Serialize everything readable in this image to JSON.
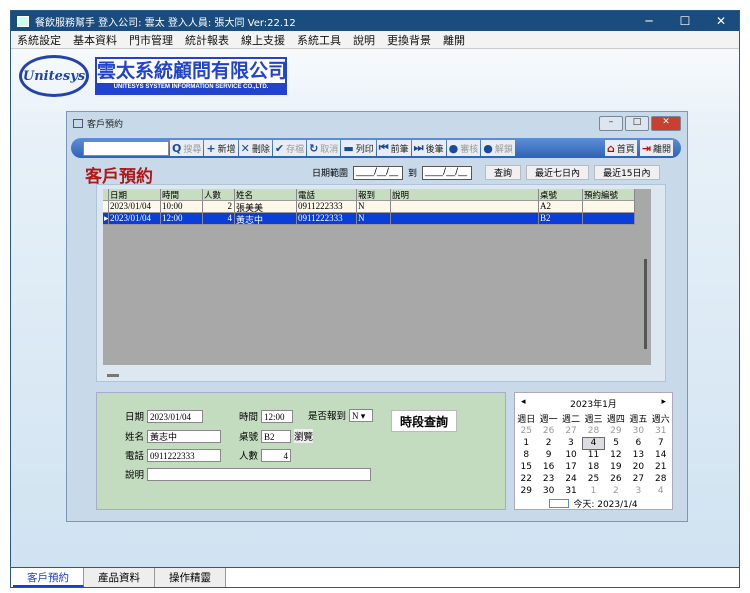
{
  "titlebar": {
    "title": "餐飲服務幫手  登入公司: 雲太  登入人員: 張大同 Ver:22.12",
    "min": "─",
    "max": "☐",
    "close": "✕"
  },
  "menu": [
    "系統設定",
    "基本資料",
    "門市管理",
    "統計報表",
    "線上支援",
    "系統工具",
    "說明",
    "更換背景",
    "離開"
  ],
  "logo": {
    "oval": "Unitesys",
    "cn": "雲太系統顧問有限公司",
    "en": "UNITESYS SYSTEM INFORMATION SERVICE CO.,LTD."
  },
  "child": {
    "title": "客戶預約",
    "heading": "客戶預約"
  },
  "toolbar": {
    "search_value": "",
    "buttons": [
      {
        "icon": "search-icon",
        "label": "搜尋",
        "glyph": "Q",
        "disabled": true
      },
      {
        "icon": "plus-icon",
        "label": "新增",
        "glyph": "+"
      },
      {
        "icon": "x-icon",
        "label": "刪除",
        "glyph": "✕"
      },
      {
        "icon": "check-icon",
        "label": "存檔",
        "glyph": "✔",
        "disabled": true
      },
      {
        "icon": "undo-icon",
        "label": "取消",
        "glyph": "↻",
        "disabled": true
      },
      {
        "icon": "printer-icon",
        "label": "列印",
        "glyph": "▬"
      },
      {
        "icon": "prev-icon",
        "label": "前筆",
        "glyph": "⏮"
      },
      {
        "icon": "next-icon",
        "label": "後筆",
        "glyph": "⏭"
      },
      {
        "icon": "lock-icon",
        "label": "審核",
        "glyph": "●",
        "disabled": true
      },
      {
        "icon": "unlock-icon",
        "label": "解鎖",
        "glyph": "●",
        "disabled": true
      }
    ],
    "home": "首頁",
    "exit": "離開"
  },
  "range": {
    "label": "日期範圍",
    "from": "____/__/__",
    "to_label": "到",
    "to": "____/__/__",
    "query": "查詢",
    "last7": "最近七日內",
    "last15": "最近15日內"
  },
  "grid": {
    "columns": [
      "日期",
      "時間",
      "人數",
      "姓名",
      "電話",
      "報到",
      "說明",
      "桌號",
      "預約編號"
    ],
    "rows": [
      [
        "2023/01/04",
        "10:00",
        "2",
        "張美美",
        "0911222333",
        "N",
        "",
        "A2",
        ""
      ],
      [
        "2023/01/04",
        "12:00",
        "4",
        "黃志中",
        "0911222333",
        "N",
        "",
        "B2",
        ""
      ]
    ],
    "selected": 1
  },
  "form": {
    "date_label": "日期",
    "date": "2023/01/04",
    "time_label": "時間",
    "time": "12:00",
    "checkin_label": "是否報到",
    "checkin": "N",
    "slot_btn": "時段查詢",
    "name_label": "姓名",
    "name": "黃志中",
    "table_label": "桌號",
    "table": "B2",
    "browse": "瀏覽",
    "phone_label": "電話",
    "phone": "0911222333",
    "people_label": "人數",
    "people": "4",
    "note_label": "說明",
    "note": ""
  },
  "calendar": {
    "title": "2023年1月",
    "weekdays": [
      "週日",
      "週一",
      "週二",
      "週三",
      "週四",
      "週五",
      "週六"
    ],
    "weeks": [
      [
        25,
        26,
        27,
        28,
        29,
        30,
        31
      ],
      [
        1,
        2,
        3,
        4,
        5,
        6,
        7
      ],
      [
        8,
        9,
        10,
        11,
        12,
        13,
        14
      ],
      [
        15,
        16,
        17,
        18,
        19,
        20,
        21
      ],
      [
        22,
        23,
        24,
        25,
        26,
        27,
        28
      ],
      [
        29,
        30,
        31,
        1,
        2,
        3,
        4
      ]
    ],
    "selected": 4,
    "today": "今天: 2023/1/4"
  },
  "tabs": [
    "客戶預約",
    "產品資料",
    "操作精靈"
  ],
  "active_tab": 0
}
